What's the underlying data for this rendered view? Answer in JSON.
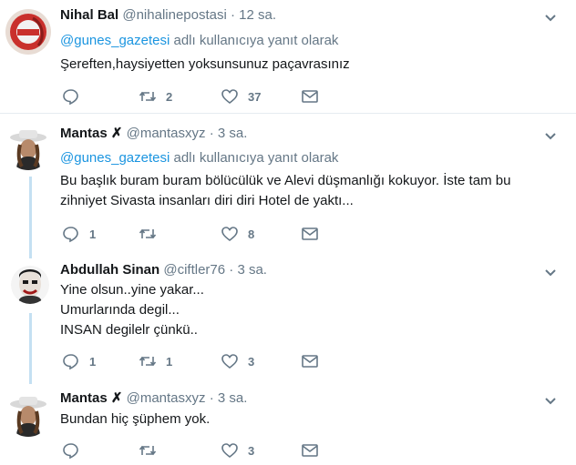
{
  "tweets": [
    {
      "name": "Nihal Bal",
      "handle": "@nihalinepostasi",
      "dot": "·",
      "time": "12 sa.",
      "reply_mention": "@gunes_gazetesi",
      "reply_suffix": " adlı kullanıcıya yanıt olarak",
      "lines": [
        "Şereften,haysiyetten yoksunsunuz paçavrasınız"
      ],
      "reply_count": "",
      "retweet_count": "2",
      "like_count": "37"
    },
    {
      "name": "Mantas ✗",
      "handle": "@mantasxyz",
      "dot": "·",
      "time": "3 sa.",
      "reply_mention": "@gunes_gazetesi",
      "reply_suffix": " adlı kullanıcıya yanıt olarak",
      "lines": [
        "Bu başlık buram buram bölücülük ve Alevi düşmanlığı kokuyor. İste tam bu",
        "zihniyet Sivasta insanları diri diri Hotel de yaktı..."
      ],
      "reply_count": "1",
      "retweet_count": "",
      "like_count": "8"
    },
    {
      "name": "Abdullah Sinan",
      "handle": "@ciftler76",
      "dot": "·",
      "time": "3 sa.",
      "lines": [
        "Yine olsun..yine yakar...",
        "Umurlarında degil...",
        "INSAN degilelr çünkü.."
      ],
      "reply_count": "1",
      "retweet_count": "1",
      "like_count": "3"
    },
    {
      "name": "Mantas ✗",
      "handle": "@mantasxyz",
      "dot": "·",
      "time": "3 sa.",
      "lines": [
        "Bundan hiç şüphem yok."
      ],
      "reply_count": "",
      "retweet_count": "",
      "like_count": "3"
    }
  ],
  "colors": {
    "link": "#1b95e0",
    "muted": "#657786",
    "thread": "#c4e0f2"
  },
  "icons": [
    "reply-icon",
    "retweet-icon",
    "like-icon",
    "direct-message-icon",
    "chevron-down-icon"
  ]
}
